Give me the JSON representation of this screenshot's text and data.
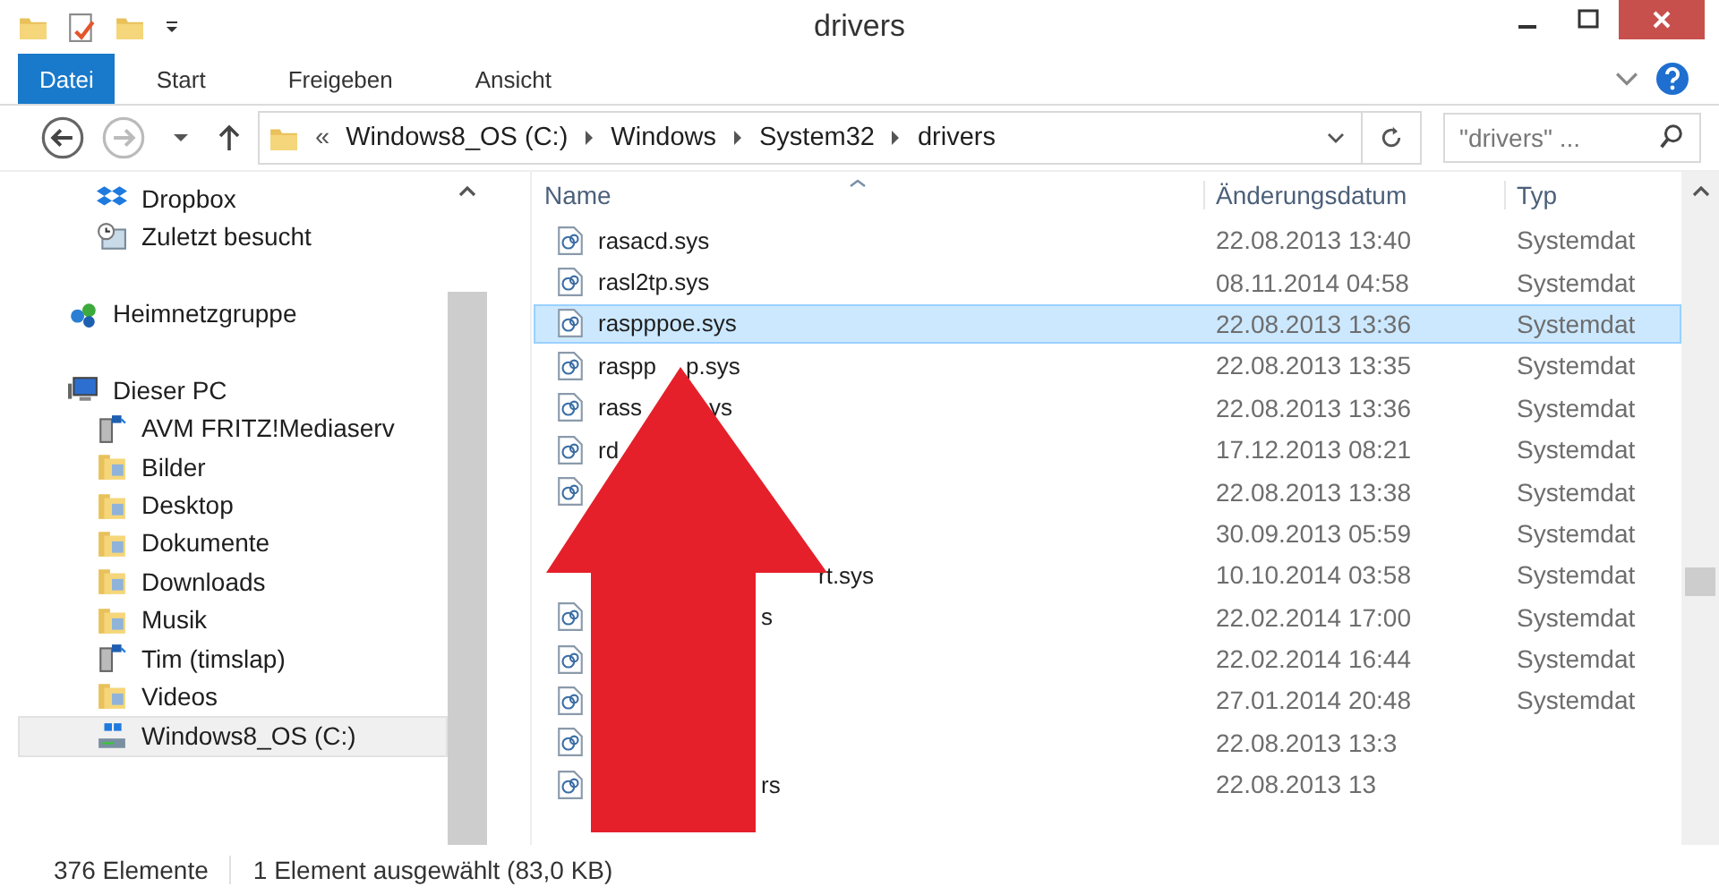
{
  "window": {
    "title": "drivers"
  },
  "ribbon": {
    "tabs": [
      {
        "label": "Datei",
        "kind": "file",
        "selected": true
      },
      {
        "label": "Start",
        "kind": "tab",
        "selected": false
      },
      {
        "label": "Freigeben",
        "kind": "tab",
        "selected": false
      },
      {
        "label": "Ansicht",
        "kind": "tab",
        "selected": false
      }
    ]
  },
  "address_bar": {
    "overflow": "«",
    "crumbs": [
      "Windows8_OS (C:)",
      "Windows",
      "System32",
      "drivers"
    ]
  },
  "search": {
    "placeholder": "\"drivers\" ..."
  },
  "nav_pane": {
    "groups": [
      {
        "items": [
          {
            "label": "Dropbox",
            "kind": "dropbox",
            "selected": false
          },
          {
            "label": "Zuletzt besucht",
            "kind": "recent",
            "selected": false
          }
        ]
      },
      {
        "label": "Heimnetzgruppe",
        "kind": "homegroup"
      },
      {
        "label": "Dieser PC",
        "kind": "pc",
        "children": [
          {
            "label": "AVM FRITZ!Mediaserv",
            "kind": "media",
            "selected": false
          },
          {
            "label": "Bilder",
            "kind": "folder",
            "selected": false
          },
          {
            "label": "Desktop",
            "kind": "folder",
            "selected": false
          },
          {
            "label": "Dokumente",
            "kind": "folder",
            "selected": false
          },
          {
            "label": "Downloads",
            "kind": "folder",
            "selected": false
          },
          {
            "label": "Musik",
            "kind": "folder",
            "selected": false
          },
          {
            "label": "Tim (timslap)",
            "kind": "media",
            "selected": false
          },
          {
            "label": "Videos",
            "kind": "folder",
            "selected": false
          },
          {
            "label": "Windows8_OS (C:)",
            "kind": "drive",
            "selected": true
          }
        ]
      }
    ]
  },
  "file_list": {
    "columns": [
      "Name",
      "Änderungsdatum",
      "Typ"
    ],
    "rows": [
      {
        "name": "rasacd.sys",
        "date": "22.08.2013 13:40",
        "type": "Systemdat",
        "selected": false
      },
      {
        "name": "rasl2tp.sys",
        "date": "08.11.2014 04:58",
        "type": "Systemdat",
        "selected": false
      },
      {
        "name": "raspppoe.sys",
        "date": "22.08.2013 13:36",
        "type": "Systemdat",
        "selected": true
      },
      {
        "name": "raspp",
        "tail": "p.sys",
        "date": "22.08.2013 13:35",
        "type": "Systemdat",
        "selected": false
      },
      {
        "name": "rass",
        "tail": "ys",
        "date": "22.08.2013 13:36",
        "type": "Systemdat",
        "selected": false
      },
      {
        "name": "rd",
        "date": "17.12.2013 08:21",
        "type": "Systemdat",
        "selected": false
      },
      {
        "date": "22.08.2013 13:38",
        "type": "Systemdat",
        "selected": false
      },
      {
        "date": "30.09.2013 05:59",
        "type": "Systemdat",
        "selected": false
      },
      {
        "tail": "rt.sys",
        "date": "10.10.2014 03:58",
        "type": "Systemdat",
        "selected": false
      },
      {
        "tail": "s",
        "date": "22.02.2014 17:00",
        "type": "Systemdat",
        "selected": false
      },
      {
        "date": "22.02.2014 16:44",
        "type": "Systemdat",
        "selected": false
      },
      {
        "date": "27.01.2014 20:48",
        "type": "Systemdat",
        "selected": false
      },
      {
        "date": "22.08.2013 13:3",
        "selected": false
      },
      {
        "tail": "rs",
        "date": "22.08.2013 13",
        "selected": false
      }
    ]
  },
  "status_bar": {
    "count": "376 Elemente",
    "selection": "1 Element ausgewählt (83,0 KB)"
  }
}
